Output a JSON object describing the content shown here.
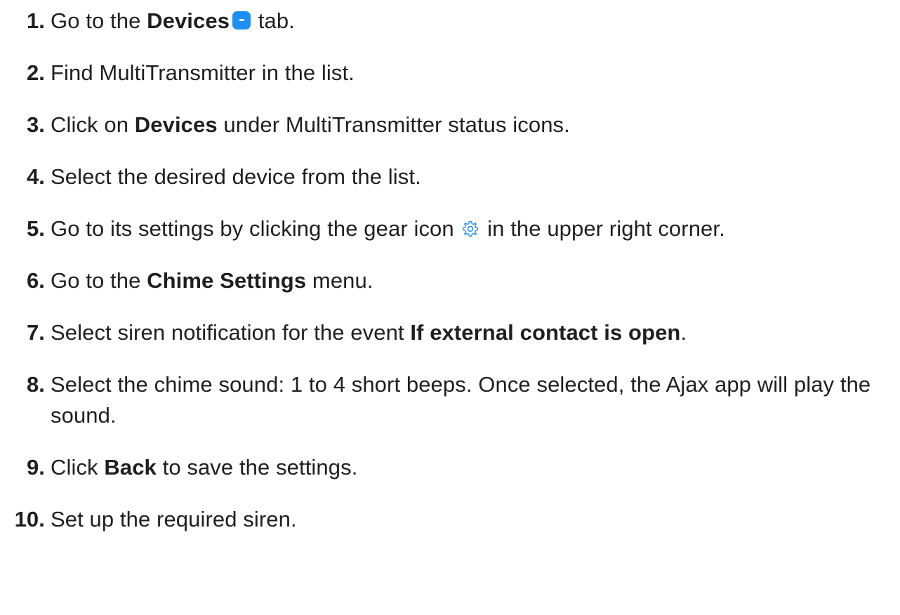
{
  "steps": [
    {
      "num": "1.",
      "pre": "Go to the ",
      "bold": "Devices",
      "post": " tab."
    },
    {
      "num": "2.",
      "text": "Find MultiTransmitter in the list."
    },
    {
      "num": "3.",
      "pre": "Click on ",
      "bold": "Devices",
      "post": " under MultiTransmitter status icons."
    },
    {
      "num": "4.",
      "text": "Select the desired device from the list."
    },
    {
      "num": "5.",
      "pre": "Go to its settings by clicking the gear icon ",
      "post": " in the upper right corner."
    },
    {
      "num": "6.",
      "pre": "Go to the ",
      "bold": "Chime Settings",
      "post": " menu."
    },
    {
      "num": "7.",
      "pre": "Select siren notification for the event ",
      "bold": "If external contact is open",
      "post": "."
    },
    {
      "num": "8.",
      "text": "Select the chime sound: 1 to 4 short beeps. Once selected, the Ajax app will play the sound."
    },
    {
      "num": "9.",
      "pre": "Click ",
      "bold": "Back",
      "post": " to save the settings."
    },
    {
      "num": "10.",
      "text": "Set up the required siren."
    }
  ],
  "icons": {
    "devices": "devices-tab-icon",
    "gear": "gear-icon"
  },
  "colors": {
    "accent": "#1f8ef1",
    "text": "#1f1f1f"
  }
}
